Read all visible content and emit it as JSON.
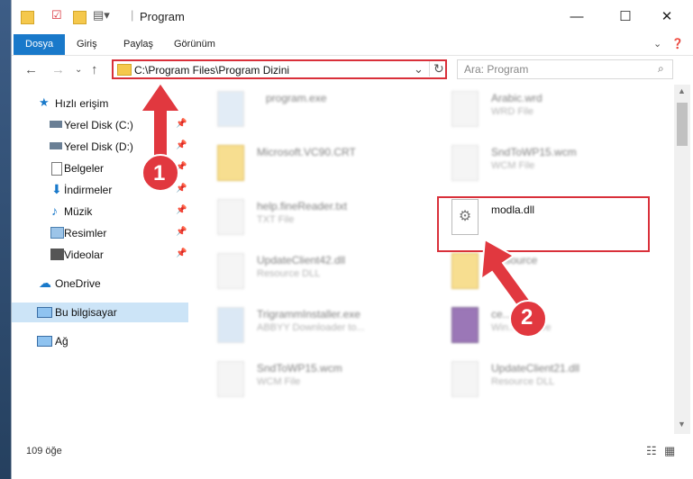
{
  "window": {
    "title": "Program"
  },
  "ribbon": {
    "tabs": [
      "Dosya",
      "Giriş",
      "Paylaş",
      "Görünüm"
    ]
  },
  "address": {
    "path": "C:\\Program Files\\Program Dizini"
  },
  "search": {
    "placeholder": "Ara: Program"
  },
  "sidebar": {
    "items": [
      {
        "label": "Hızlı erişim",
        "icon": "star-icon"
      },
      {
        "label": "Yerel Disk (C:)",
        "icon": "drive-icon"
      },
      {
        "label": "Yerel Disk (D:)",
        "icon": "drive-icon"
      },
      {
        "label": "Belgeler",
        "icon": "document-icon"
      },
      {
        "label": "İndirmeler",
        "icon": "download-icon"
      },
      {
        "label": "Müzik",
        "icon": "music-icon"
      },
      {
        "label": "Resimler",
        "icon": "pictures-icon"
      },
      {
        "label": "Videolar",
        "icon": "video-icon"
      },
      {
        "label": "OneDrive",
        "icon": "cloud-icon"
      },
      {
        "label": "Bu bilgisayar",
        "icon": "computer-icon"
      },
      {
        "label": "Ağ",
        "icon": "network-icon"
      }
    ]
  },
  "files": [
    {
      "name": "program.exe",
      "sub": ""
    },
    {
      "name": "Arabic.wrd",
      "sub": "WRD File"
    },
    {
      "name": "Microsoft.VC90.CRT",
      "sub": ""
    },
    {
      "name": "SndToWP15.wcm",
      "sub": "WCM File"
    },
    {
      "name": "help.fineReader.txt",
      "sub": "TXT File"
    },
    {
      "name": "modla.dll",
      "sub": ""
    },
    {
      "name": "UpdateClient42.dll",
      "sub": "Resource DLL"
    },
    {
      "name": "Resource",
      "sub": ""
    },
    {
      "name": "TrigrammInstaller.exe",
      "sub": "ABBYY Downloader to..."
    },
    {
      "name": "ce...es.cab",
      "sub": "Win... archive"
    },
    {
      "name": "SndToWP15.wcm",
      "sub": "WCM File"
    },
    {
      "name": "UpdateClient21.dll",
      "sub": "Resource DLL"
    }
  ],
  "status": {
    "count": "109 öğe"
  },
  "annotations": {
    "step1": "1",
    "step2": "2"
  },
  "colors": {
    "accent": "#1979ca",
    "highlight": "#d9303a"
  }
}
